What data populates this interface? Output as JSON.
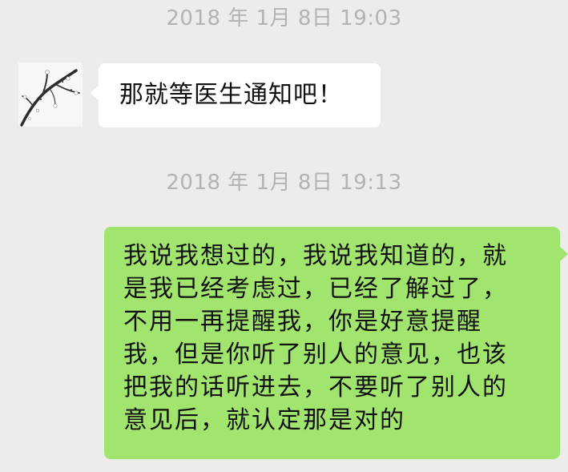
{
  "chat": {
    "timestamps": [
      "2018 年 1月 8日 19:03",
      "2018 年 1月 8日 19:13"
    ],
    "incoming": {
      "avatar_icon": "plum-blossom-branch-avatar",
      "text": "那就等医生通知吧！"
    },
    "outgoing": {
      "lines": [
        "我说我想过的，我说我知道的，就",
        "是我已经考虑过，已经了解过了，",
        "不用一再提醒我，你是好意提醒",
        "我，但是你听了别人的意见，也该",
        "把我的话听进去，不要听了别人的",
        "意见后，就认定那是对的"
      ]
    }
  },
  "colors": {
    "background": "#ececec",
    "incoming_bubble": "#ffffff",
    "outgoing_bubble": "#a2e56e",
    "timestamp": "#b3b3b3"
  }
}
